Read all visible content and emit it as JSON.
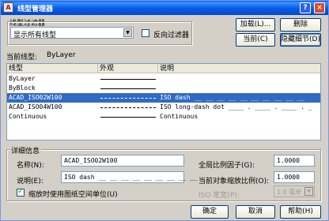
{
  "window": {
    "title": "线型管理器",
    "help_glyph": "?",
    "close_glyph": "×",
    "app_icon": "A"
  },
  "filter": {
    "group_label": "线型过滤器",
    "selected": "显示所有线型",
    "invert_label": "反向过滤器",
    "invert_checked": false
  },
  "buttons": {
    "load": "加载(L)...",
    "delete": "删除",
    "current": "当前(C)",
    "hide_details": "隐藏细节(D)",
    "ok": "确定",
    "cancel": "取消",
    "help": "帮助(H)"
  },
  "current_linetype": {
    "label": "当前线型:",
    "value": "ByLayer"
  },
  "list": {
    "columns": [
      "线型",
      "外观",
      "说明"
    ],
    "rows": [
      {
        "name": "ByLayer",
        "appearance": "solid",
        "description": "",
        "selected": false
      },
      {
        "name": "ByBlock",
        "appearance": "solid",
        "description": "",
        "selected": false
      },
      {
        "name": "ACAD_ISO02W100",
        "appearance": "dashed",
        "description": "ISO dash __ __ __ __ __ __ __ __ __ __",
        "selected": true
      },
      {
        "name": "ACAD_ISO04W100",
        "appearance": "dashed",
        "description": "ISO long-dash dot ____ . ____ . ____ . _",
        "selected": false
      },
      {
        "name": "Continuous",
        "appearance": "solid",
        "description": "Continuous",
        "selected": false
      }
    ]
  },
  "details": {
    "group_label": "详细信息",
    "name_label": "名称(N):",
    "name_value": "ACAD_ISO02W100",
    "desc_label": "说明(E):",
    "desc_value": "ISO dash __ __ __ __ __ __ __ __ __",
    "paper_space_label": "缩放时使用图纸空间单位(U)",
    "paper_space_checked": true,
    "global_scale_label": "全局比例因子(G):",
    "global_scale_value": "1.0000",
    "current_scale_label": "当前对象缩放比例(O):",
    "current_scale_value": "1.0000",
    "iso_pen_label": "ISO 笔宽(P):",
    "iso_pen_value": "1.0 毫米"
  }
}
